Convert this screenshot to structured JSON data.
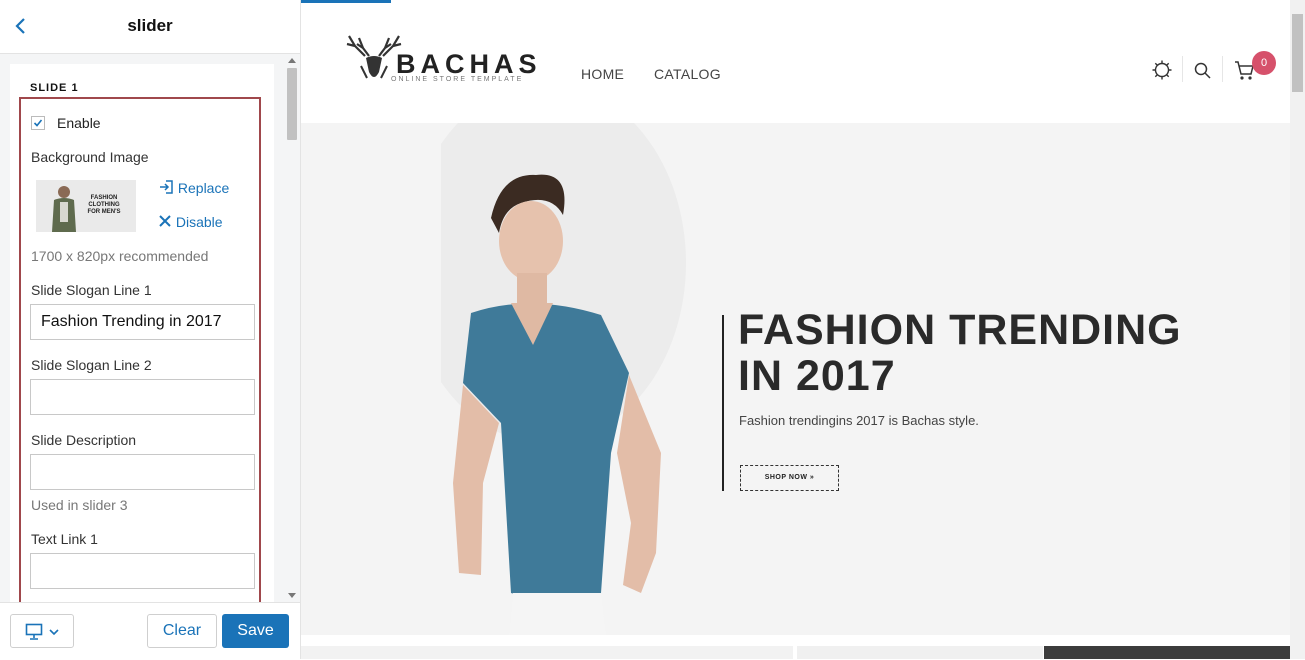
{
  "panel": {
    "title": "slider",
    "section_title": "SLIDE 1",
    "enable": {
      "label": "Enable",
      "checked": true
    },
    "background_image": {
      "label": "Background Image",
      "thumb_text": "FASHION CLOTHING FOR MEN'S",
      "replace_label": "Replace",
      "disable_label": "Disable",
      "hint": "1700 x 820px recommended"
    },
    "slogan1": {
      "label": "Slide Slogan Line 1",
      "value": "Fashion Trending in 2017"
    },
    "slogan2": {
      "label": "Slide Slogan Line 2",
      "value": ""
    },
    "description": {
      "label": "Slide Description",
      "value": "",
      "hint": "Used in slider 3"
    },
    "text_link1": {
      "label": "Text Link 1",
      "value": ""
    }
  },
  "footer": {
    "clear_label": "Clear",
    "save_label": "Save",
    "device_icon": "desktop-icon"
  },
  "preview": {
    "logo": {
      "name": "BACHAS",
      "tagline": "ONLINE STORE TEMPLATE"
    },
    "nav": [
      "HOME",
      "CATALOG"
    ],
    "cart_count": "0",
    "hero": {
      "title": "FASHION TRENDING IN 2017",
      "description": "Fashion trendingins 2017 is Bachas style.",
      "button": "SHOP NOW  »"
    }
  },
  "colors": {
    "accent": "#1a73b8",
    "highlight_border": "#a0484c",
    "badge": "#d6516b"
  }
}
